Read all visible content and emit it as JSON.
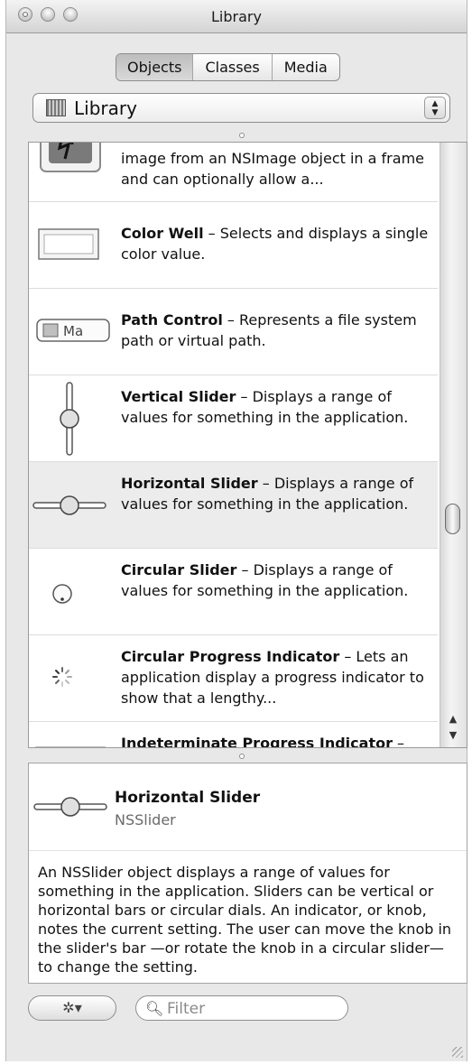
{
  "window": {
    "title": "Library"
  },
  "tabs": [
    "Objects",
    "Classes",
    "Media"
  ],
  "popup": {
    "label": "Library"
  },
  "items": [
    {
      "name": "",
      "desc": "image from an NSImage object in a frame and can optionally allow a...",
      "icon": "image-well-icon"
    },
    {
      "name": "Color Well",
      "desc": " – Selects and displays a single color value.",
      "icon": "color-well-icon"
    },
    {
      "name": "Path Control",
      "desc": " – Represents a file system path or virtual path.",
      "icon": "path-control-icon",
      "icon_text": "Ma"
    },
    {
      "name": "Vertical Slider",
      "desc": " – Displays a range of values for something in the application.",
      "icon": "vertical-slider-icon"
    },
    {
      "name": "Horizontal Slider",
      "desc": " – Displays a range of values for something in the application.",
      "icon": "horizontal-slider-icon",
      "selected": true
    },
    {
      "name": "Circular Slider",
      "desc": " – Displays a range of values for something in the application.",
      "icon": "circular-slider-icon"
    },
    {
      "name": "Circular Progress Indicator",
      "desc": " – Lets an application display a progress indicator to show that a lengthy...",
      "icon": "circular-progress-icon"
    },
    {
      "name": "Indeterminate Progress Indicator",
      "desc": " –",
      "icon": "indeterminate-progress-icon"
    }
  ],
  "detail": {
    "title": "Horizontal Slider",
    "class_name": "NSSlider",
    "description": "An NSSlider object displays a range of values for something in the application. Sliders can be vertical or horizontal bars or circular dials. An indicator, or knob, notes the current setting. The user can move the knob in the slider's bar —or rotate the knob in a circular slider—to change the setting."
  },
  "filter": {
    "placeholder": "Filter",
    "value": ""
  }
}
